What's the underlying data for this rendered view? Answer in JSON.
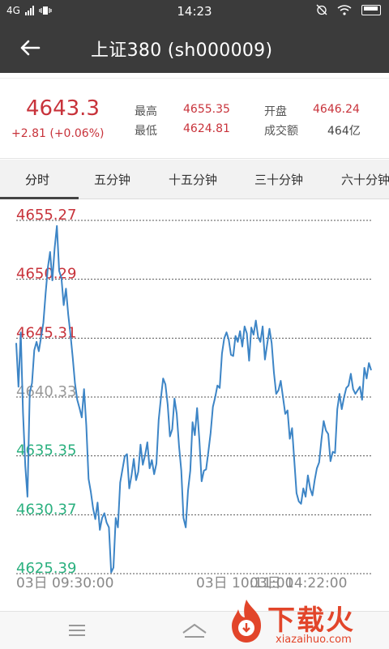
{
  "status_bar": {
    "network": "4G",
    "time": "14:23"
  },
  "header": {
    "title": "上证380 (sh000009)"
  },
  "quote": {
    "last_price": "4643.3",
    "change": "+2.81 (+0.06%)",
    "high_label": "最高",
    "high_value": "4655.35",
    "low_label": "最低",
    "low_value": "4624.81",
    "open_label": "开盘",
    "open_value": "4646.24",
    "turnover_label": "成交额",
    "turnover_value": "464亿"
  },
  "tabs": [
    {
      "label": "分时",
      "active": true
    },
    {
      "label": "五分钟",
      "active": false
    },
    {
      "label": "十五分钟",
      "active": false
    },
    {
      "label": "三十分钟",
      "active": false
    },
    {
      "label": "六十分钟",
      "active": false
    }
  ],
  "colors": {
    "up": "#c8333b",
    "down": "#2bb07f",
    "neutral": "#999999",
    "line": "#3d85c6"
  },
  "chart_data": {
    "type": "line",
    "y_ticks": [
      {
        "value": "4655.27",
        "tone": "up"
      },
      {
        "value": "4650.29",
        "tone": "up"
      },
      {
        "value": "4645.31",
        "tone": "up"
      },
      {
        "value": "4640.33",
        "tone": "neutral"
      },
      {
        "value": "4635.35",
        "tone": "down"
      },
      {
        "value": "4630.37",
        "tone": "down"
      },
      {
        "value": "4625.39",
        "tone": "down"
      }
    ],
    "x_labels": [
      "03日 09:30:00",
      "03日 10:11:00",
      "03日 14:22:00"
    ],
    "ylim": [
      4625.39,
      4655.27
    ],
    "grid": true,
    "series": [
      {
        "values": [
          4644.9,
          4641.2,
          4645.8,
          4639.0,
          4634.5,
          4631.9,
          4640.7,
          4641.5,
          4644.3,
          4645.0,
          4644.2,
          4645.4,
          4646.6,
          4649.1,
          4651.3,
          4652.6,
          4650.2,
          4652.9,
          4654.8,
          4651.0,
          4650.4,
          4648.1,
          4649.5,
          4647.3,
          4645.6,
          4643.7,
          4641.5,
          4640.1,
          4639.4,
          4638.6,
          4641.0,
          4637.9,
          4633.4,
          4632.3,
          4630.9,
          4630.0,
          4631.4,
          4629.1,
          4630.1,
          4630.5,
          4629.7,
          4629.3,
          4625.5,
          4625.9,
          4630.1,
          4629.3,
          4633.1,
          4634.2,
          4635.3,
          4635.5,
          4632.6,
          4633.7,
          4635.1,
          4633.3,
          4634.0,
          4636.3,
          4634.6,
          4635.4,
          4636.5,
          4634.3,
          4635.0,
          4633.8,
          4634.7,
          4638.4,
          4640.2,
          4641.9,
          4641.4,
          4639.7,
          4637.0,
          4637.6,
          4640.2,
          4638.9,
          4636.2,
          4634.1,
          4630.1,
          4629.3,
          4632.4,
          4634.1,
          4638.2,
          4637.1,
          4639.4,
          4636.7,
          4633.2,
          4634.1,
          4634.2,
          4635.7,
          4637.3,
          4639.5,
          4640.3,
          4641.3,
          4641.1,
          4644.0,
          4645.3,
          4645.8,
          4645.2,
          4643.9,
          4643.8,
          4645.5,
          4645.0,
          4645.9,
          4644.6,
          4646.3,
          4645.7,
          4643.4,
          4646.2,
          4645.6,
          4646.8,
          4645.4,
          4645.0,
          4646.3,
          4643.5,
          4644.8,
          4646.1,
          4644.9,
          4642.4,
          4640.6,
          4640.9,
          4641.7,
          4640.3,
          4638.9,
          4639.2,
          4636.8,
          4637.7,
          4635.0,
          4632.2,
          4631.5,
          4631.3,
          4632.6,
          4631.9,
          4633.7,
          4632.6,
          4632.0,
          4633.3,
          4634.3,
          4634.8,
          4636.7,
          4638.3,
          4637.5,
          4637.2,
          4634.9,
          4635.7,
          4635.6,
          4639.3,
          4640.6,
          4639.3,
          4640.3,
          4641.1,
          4641.3,
          4642.3,
          4641.0,
          4640.6,
          4640.9,
          4641.2,
          4640.1,
          4642.8,
          4641.9,
          4643.2,
          4642.6
        ]
      }
    ]
  },
  "watermark": {
    "logo_text": "下载火",
    "url": "xiazaihuo.com"
  }
}
